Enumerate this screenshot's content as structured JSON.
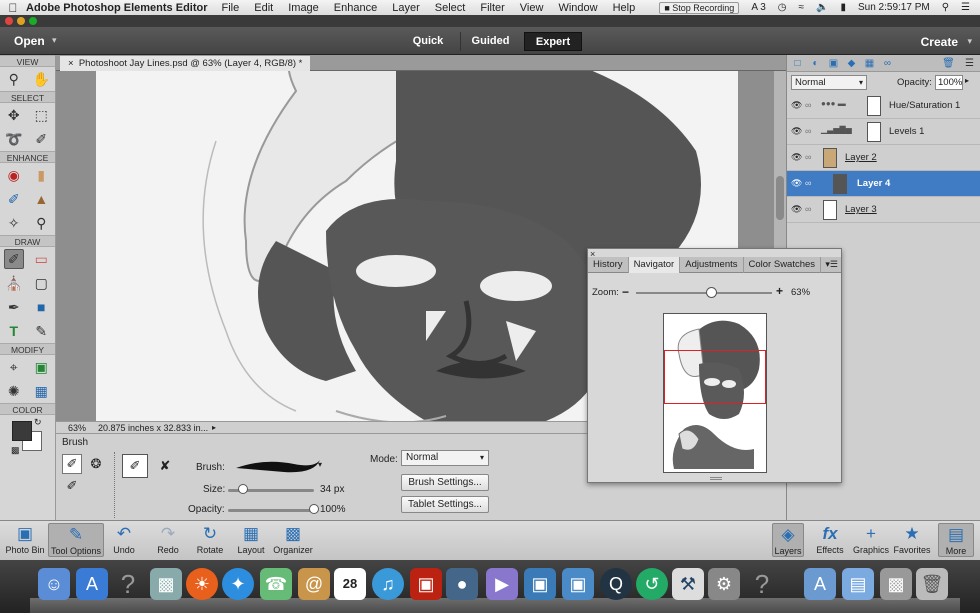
{
  "menubar": {
    "app_name": "Adobe Photoshop Elements Editor",
    "items": [
      "File",
      "Edit",
      "Image",
      "Enhance",
      "Layer",
      "Select",
      "Filter",
      "View",
      "Window",
      "Help"
    ],
    "stop_recording": "Stop Recording",
    "clock": "Sun 2:59:17 PM"
  },
  "modebar": {
    "open": "Open",
    "quick": "Quick",
    "guided": "Guided",
    "expert": "Expert",
    "create": "Create"
  },
  "toolbox": {
    "sections": {
      "view": "VIEW",
      "select": "SELECT",
      "enhance": "ENHANCE",
      "draw": "DRAW",
      "modify": "MODIFY",
      "color": "COLOR"
    },
    "foreground_color": "#3a3a3a",
    "background_color": "#ffffff"
  },
  "document": {
    "tab_title": "Photoshoot Jay Lines.psd @ 63% (Layer 4, RGB/8) *",
    "zoom": "63%",
    "doc_size": "20.875 inches x 32.833 in..."
  },
  "tool_options": {
    "title": "Brush",
    "brush_label": "Brush:",
    "size_label": "Size:",
    "size_value": "34 px",
    "size_level": 0.18,
    "opacity_label": "Opacity:",
    "opacity_value": "100%",
    "opacity_level": 1.0,
    "mode_label": "Mode:",
    "mode_value": "Normal",
    "brush_settings": "Brush Settings...",
    "tablet_settings": "Tablet Settings..."
  },
  "layers": {
    "blend_mode": "Normal",
    "opacity_label": "Opacity:",
    "opacity_value": "100%",
    "items": [
      {
        "name": "Hue/Saturation 1",
        "selected": false
      },
      {
        "name": "Levels 1",
        "selected": false
      },
      {
        "name": "Layer 2",
        "selected": false
      },
      {
        "name": "Layer 4",
        "selected": true
      },
      {
        "name": "Layer 3",
        "selected": false
      }
    ],
    "selection_color": "#3f7cc4"
  },
  "navigator": {
    "tabs": [
      "History",
      "Navigator",
      "Adjustments",
      "Color Swatches"
    ],
    "active_tab": "Navigator",
    "zoom_label": "Zoom:",
    "zoom_value": "63%",
    "zoom_level": 0.55,
    "viewbox_color": "#dd2222"
  },
  "taskbar": {
    "left": [
      "Photo Bin",
      "Tool Options",
      "Undo",
      "Redo",
      "Rotate",
      "Layout",
      "Organizer"
    ],
    "right": [
      "Layers",
      "Effects",
      "Graphics",
      "Favorites",
      "More"
    ]
  },
  "dock": {
    "calendar_day": "28"
  }
}
